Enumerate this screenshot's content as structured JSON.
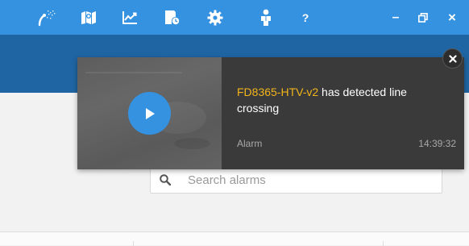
{
  "topbar": {
    "icons": [
      "wand-icon",
      "map-icon",
      "chart-icon",
      "schedule-icon",
      "gear-icon",
      "user-icon",
      "help-icon"
    ],
    "help_label": "?",
    "window_controls": [
      "minimize-icon",
      "restore-icon",
      "close-icon"
    ],
    "minimize_label": "–",
    "close_label": "×"
  },
  "search": {
    "placeholder": "Search alarms"
  },
  "toast": {
    "device": "FD8365-HTV-v2",
    "message": " has detected line crossing",
    "type": "Alarm",
    "time": "14:39:32",
    "close_label": "×"
  },
  "colors": {
    "topbar": "#3592e0",
    "band": "#1f65a3",
    "accent_text": "#f3b51b",
    "toast_bg": "#3a3a3a"
  }
}
